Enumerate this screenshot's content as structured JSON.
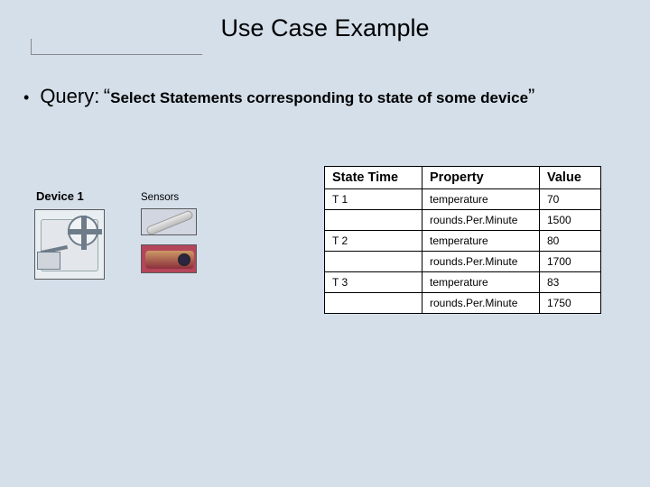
{
  "title": "Use Case Example",
  "bullet": {
    "label": "Query:",
    "open_quote": "“",
    "text": "Select Statements corresponding to state of some device",
    "close_quote": "”"
  },
  "device_label": "Device 1",
  "sensors_label": "Sensors",
  "table": {
    "headers": {
      "state_time": "State Time",
      "property": "Property",
      "value": "Value"
    },
    "rows": [
      {
        "state_time": "T 1",
        "property": "temperature",
        "value": "70"
      },
      {
        "state_time": "",
        "property": "rounds.Per.Minute",
        "value": "1500"
      },
      {
        "state_time": "T 2",
        "property": "temperature",
        "value": "80"
      },
      {
        "state_time": "",
        "property": "rounds.Per.Minute",
        "value": "1700"
      },
      {
        "state_time": "T 3",
        "property": "temperature",
        "value": "83"
      },
      {
        "state_time": "",
        "property": "rounds.Per.Minute",
        "value": "1750"
      }
    ]
  }
}
